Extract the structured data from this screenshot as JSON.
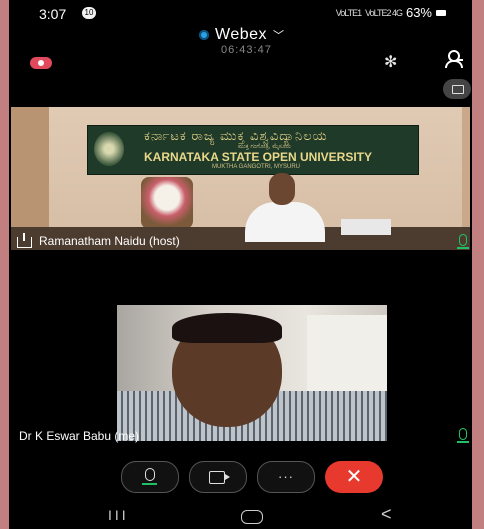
{
  "status_bar": {
    "time": "3:07",
    "notification_count": "10",
    "carrier_1": "VoLTE1",
    "carrier_2": "VoLTE2 4G",
    "battery": "63%"
  },
  "app": {
    "title": "Webex",
    "call_timer": "06:43:47"
  },
  "icons": {
    "bluetooth": "bluetooth-icon",
    "participants": "participants-icon",
    "recording": "recording-icon",
    "layout": "layout-icon",
    "share": "share-icon",
    "mic": "mic-icon",
    "video": "video-icon",
    "more": "more-icon",
    "end": "end-call-icon"
  },
  "host_video": {
    "banner_kannada": "ಕರ್ನಾಟಕ ರಾಜ್ಯ ಮುಕ್ತ ವಿಶ್ವವಿದ್ಯಾನಿಲಯ",
    "banner_sub_kannada": "ಮುಕ್ತ ಗಂಗೋತ್ರಿ, ಮೈಸೂರು",
    "banner_english": "KARNATAKA STATE OPEN UNIVERSITY",
    "banner_sub_english": "MUKTHA GANGOTRI, MYSURU",
    "participant_name": "Ramanatham Naidu (host)"
  },
  "self_video": {
    "participant_name": "Dr K Eswar Babu (me)"
  },
  "controls": {
    "more_label": "···",
    "end_label": "✕"
  },
  "navigation": {
    "recent_label": "III",
    "back_label": "<"
  },
  "colors": {
    "background_frame": "#c98a8a",
    "accent_green": "#21c064",
    "end_call_red": "#e8392f",
    "webex_blue": "#2aa3e5"
  }
}
